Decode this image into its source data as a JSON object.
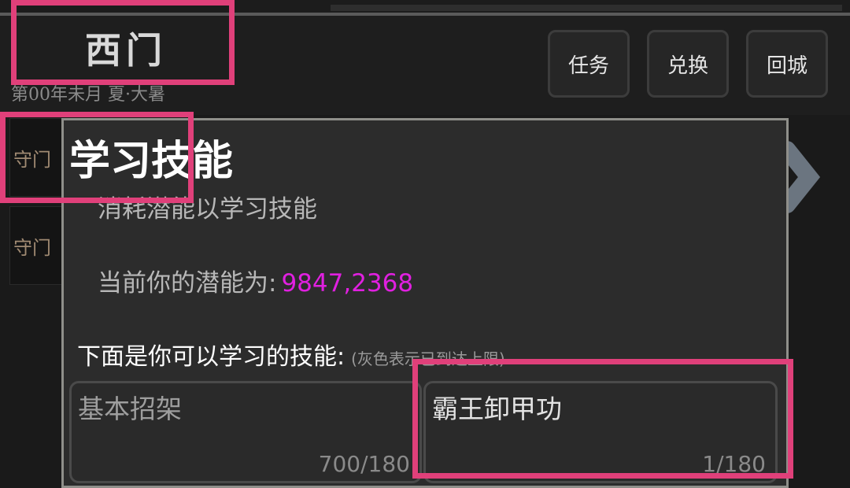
{
  "header": {
    "location": "西门",
    "date_line": "第00年未月 夏·大暑",
    "buttons": {
      "task": "任务",
      "exchange": "兑换",
      "return_city": "回城"
    }
  },
  "sidebar": {
    "items": [
      {
        "label": "守门"
      },
      {
        "label": "守门"
      }
    ]
  },
  "dialog": {
    "title": "学习技能",
    "subtitle": "消耗潜能以学习技能",
    "potential_label": "当前你的潜能为:",
    "potential_value": "9847,2368",
    "list_title": "下面是你可以学习的技能:",
    "list_note": "(灰色表示已到达上限)",
    "skills": [
      {
        "name": "基本招架",
        "progress": "700/180",
        "maxed": true
      },
      {
        "name": "霸王卸甲功",
        "progress": "1/180",
        "maxed": false
      }
    ]
  },
  "colors": {
    "highlight": "#e0407a",
    "potential_value": "#e020e0",
    "dialog_border": "#8f8f8a"
  }
}
